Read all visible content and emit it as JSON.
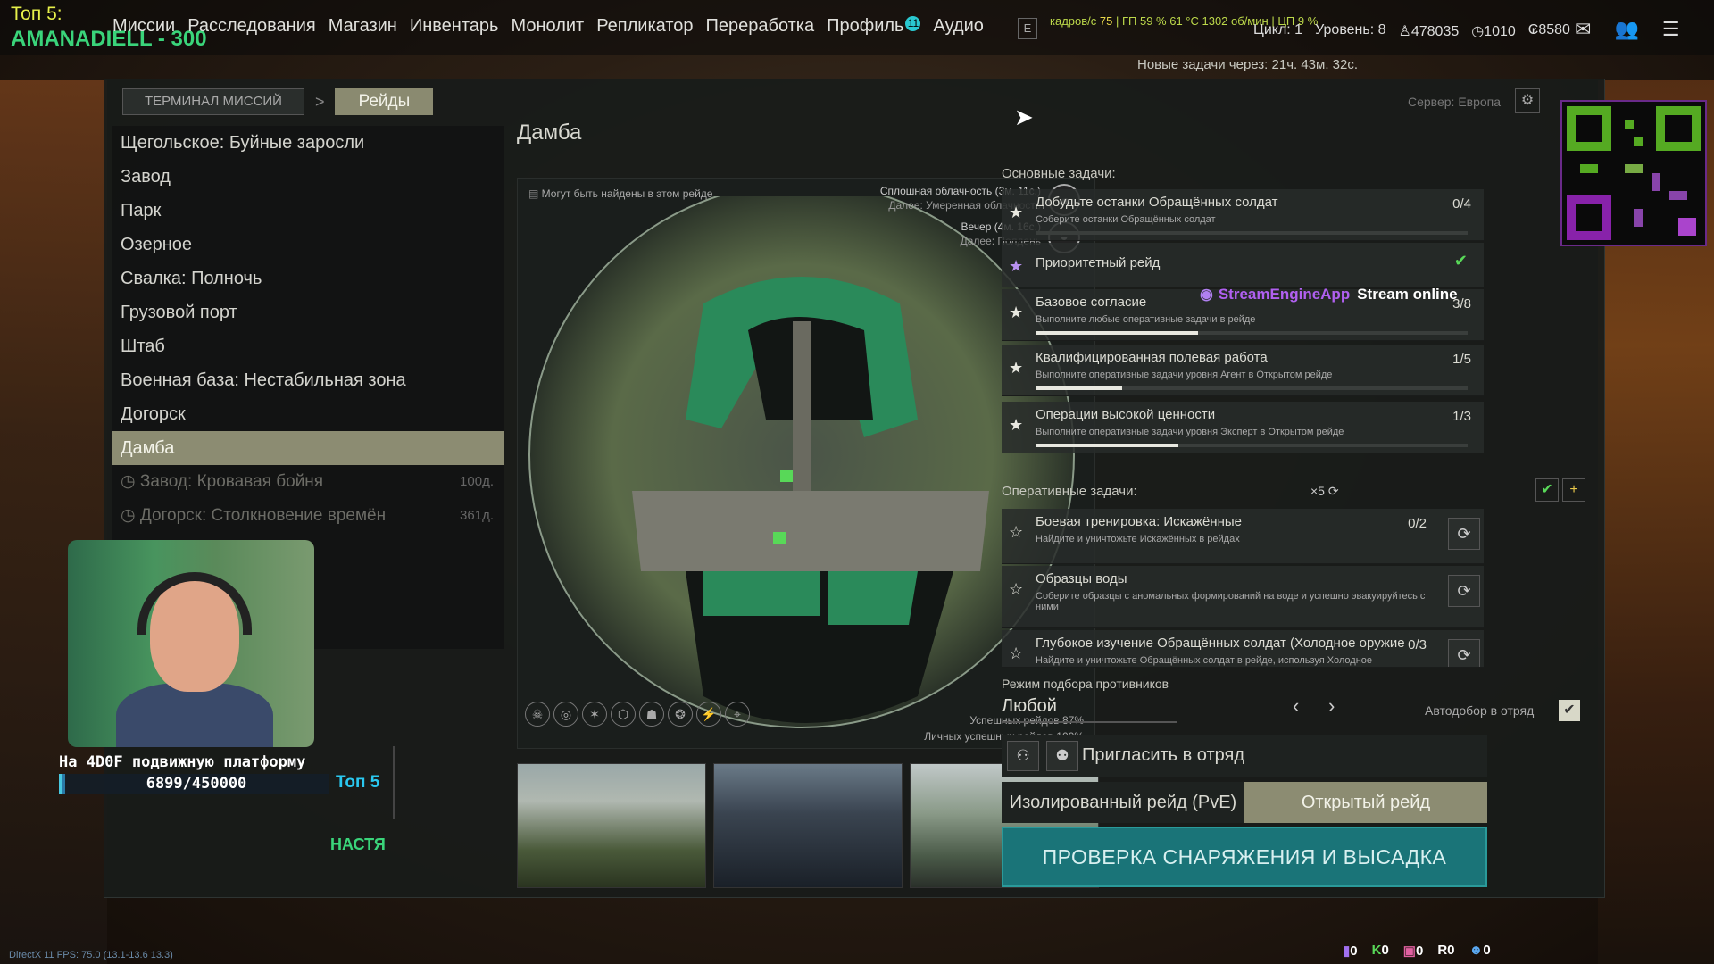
{
  "stream": {
    "top_label": "Топ 5:",
    "top_name": "AMANADIELL - 300",
    "overlay_text": "На 4D0F подвижную платформу",
    "overlay_progress": "6899/450000",
    "overlay_progress_fraction": 0.015,
    "overlay_top": "Топ 5",
    "overlay_tail": "НАСТЯ",
    "engine_name": "StreamEngineApp",
    "engine_status": "Stream online"
  },
  "nav": {
    "items": [
      "Миссии",
      "Расследования",
      "Магазин",
      "Инвентарь",
      "Монолит",
      "Репликатор",
      "Переработка",
      "Профиль",
      "Аудио"
    ],
    "profile_badge": "11",
    "key_hint": "E"
  },
  "perf": {
    "fps_label": "кадров/с",
    "fps_value": "75",
    "gpu": "ГП 59 % 61 °C 1302 об/мин",
    "cpu": "ЦП 9 %"
  },
  "stats": {
    "cycle": "Цикл: 1",
    "level": "Уровень: 8",
    "rep": "478035",
    "currency1": "1010",
    "currency2": "8580"
  },
  "crumbs": {
    "terminal": "ТЕРМИНАЛ МИССИЙ",
    "raids": "Рейды",
    "server": "Сервер: Европа"
  },
  "locations": [
    "Щегольское: Буйные заросли",
    "Завод",
    "Парк",
    "Озерное",
    "Свалка: Полночь",
    "Грузовой порт",
    "Штаб",
    "Военная база: Нестабильная зона",
    "Догорск",
    "Дамба"
  ],
  "selected_location": "Дамба",
  "events": [
    {
      "name": "Завод: Кровавая бойня",
      "days": "100д."
    },
    {
      "name": "Догорск: Столкновение времён",
      "days": "361д."
    }
  ],
  "map": {
    "title": "Дамба",
    "note": "Могут быть найдены в этом рейде",
    "weather_now": "Сплошная облачность (3м. 11с.)",
    "weather_next": "Далее: Умеренная облачность",
    "time_now": "Вечер (4м. 16с.)",
    "time_next": "Далее: Полдень",
    "success_raids": "Успешных рейдов 87%",
    "personal_success": "Личных успешных рейдов 100%"
  },
  "tasks": {
    "new_in": "Новые задачи через: 21ч. 43м. 32с.",
    "main_label": "Основные задачи:",
    "main": [
      {
        "title": "Добудьте останки Обращённых солдат",
        "desc": "Соберите останки Обращённых солдат",
        "count": "0/4",
        "progress": 0.0,
        "priority": false
      },
      {
        "title": "Приоритетный рейд",
        "desc": "",
        "count": "",
        "progress": null,
        "priority": true,
        "done": true
      },
      {
        "title": "Базовое согласие",
        "desc": "Выполните любые оперативные задачи в рейде",
        "count": "3/8",
        "progress": 0.375,
        "priority": false
      },
      {
        "title": "Квалифицированная полевая работа",
        "desc": "Выполните оперативные задачи уровня Агент в Открытом рейде",
        "count": "1/5",
        "progress": 0.2,
        "priority": false
      },
      {
        "title": "Операции высокой ценности",
        "desc": "Выполните оперативные задачи уровня Эксперт в Открытом рейде",
        "count": "1/3",
        "progress": 0.33,
        "priority": false
      }
    ],
    "op_label": "Оперативные задачи:",
    "op_multiplier": "×5",
    "op": [
      {
        "title": "Боевая тренировка: Искажённые",
        "desc": "Найдите и уничтожьте Искажённых в рейдах",
        "count": "0/2"
      },
      {
        "title": "Образцы воды",
        "desc": "Соберите образцы с аномальных формирований на воде и успешно эвакуируйтесь с ними",
        "count": ""
      },
      {
        "title": "Глубокое изучение Обращённых солдат (Холодное оружие",
        "desc": "Найдите и уничтожьте Обращённых солдат в рейде, используя Холодное",
        "count": "0/3"
      }
    ]
  },
  "matchmaking": {
    "label": "Режим подбора противников",
    "value": "Любой",
    "auto_label": "Автодобор в отряд",
    "auto_checked": true
  },
  "squad": {
    "invite": "Пригласить в отряд"
  },
  "raid_modes": {
    "isolated": "Изолированный рейд (PvE)",
    "open": "Открытый рейд",
    "selected": "open"
  },
  "deploy": "ПРОВЕРКА СНАРЯЖЕНИЯ И ВЫСАДКА",
  "footer": {
    "left": "DirectX 11 FPS: 75.0 (13.1-13.6 13.3)",
    "counters": [
      "0",
      "0",
      "0",
      "0",
      "0"
    ]
  },
  "colors": {
    "accent_selected": "#8c8c72",
    "deploy": "#1a7478",
    "map_green": "#2a8a5a",
    "fps_green": "#bcd84a"
  }
}
